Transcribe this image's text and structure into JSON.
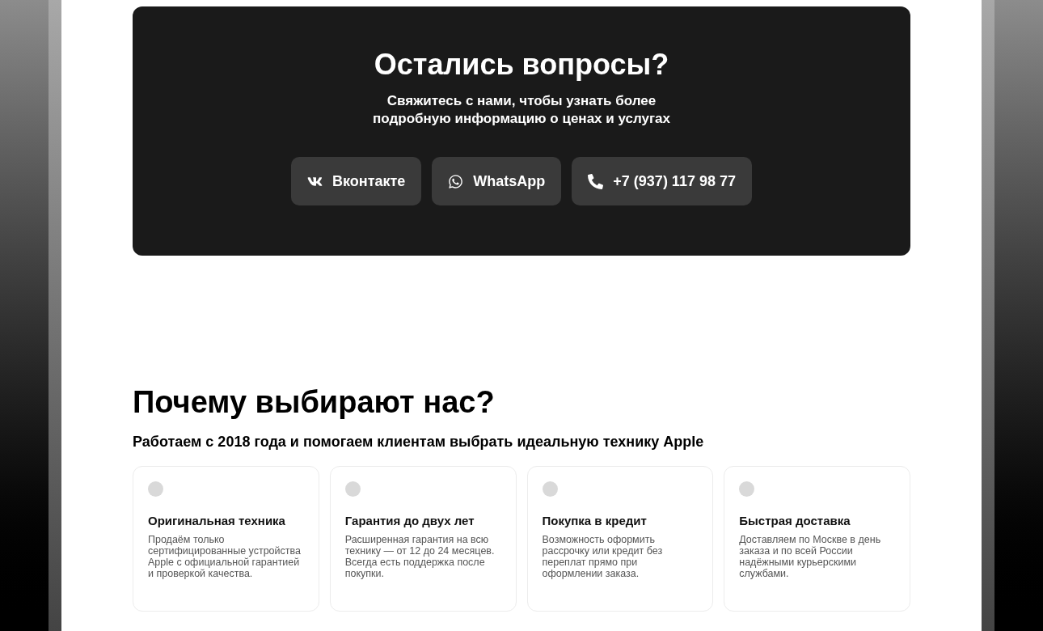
{
  "contact": {
    "title": "Остались вопросы?",
    "subtitle": "Свяжитесь с нами, чтобы узнать более подробную информацию о ценах и услугах",
    "buttons": [
      {
        "kind": "vk",
        "label": "Вконтакте"
      },
      {
        "kind": "whatsapp",
        "label": "WhatsApp"
      },
      {
        "kind": "phone",
        "label": "+7 (937) 117 98 77"
      }
    ]
  },
  "why": {
    "title": "Почему выбирают нас?",
    "subtitle": "Работаем с 2018 года и помогаем клиентам выбрать идеальную технику Apple",
    "cards": [
      {
        "title": "Оригинальная техника",
        "text": "Продаём только сертифицированные устройства Apple с официальной гарантией и проверкой качества."
      },
      {
        "title": "Гарантия до двух лет",
        "text": "Расширенная гарантия на всю технику — от 12 до 24 месяцев. Всегда есть поддержка после покупки."
      },
      {
        "title": "Покупка в кредит",
        "text": "Возможность оформить рассрочку или кредит без переплат прямо при оформлении заказа."
      },
      {
        "title": "Быстрая доставка",
        "text": "Доставляем по Москве в день заказа и по всей России надёжными курьерскими службами."
      }
    ]
  }
}
